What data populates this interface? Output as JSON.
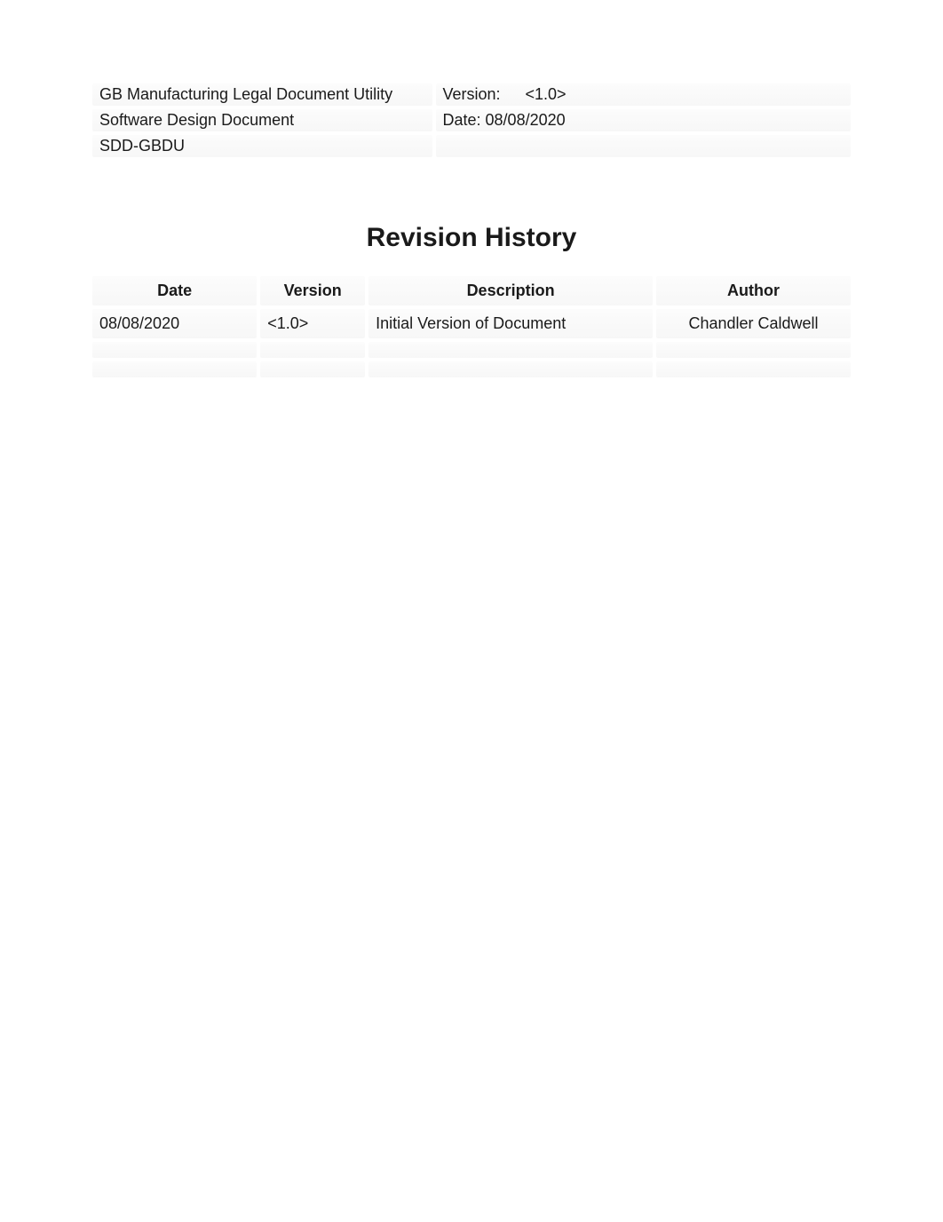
{
  "header": {
    "title": "GB Manufacturing Legal Document Utility",
    "doc_type": "Software Design Document",
    "doc_id": "SDD-GBDU",
    "version_label": "Version:",
    "version_value": "<1.0>",
    "date_label": "Date: ",
    "date_value": "08/08/2020"
  },
  "page_title": "Revision History",
  "revision_table": {
    "headers": {
      "date": "Date",
      "version": "Version",
      "description": "Description",
      "author": "Author"
    },
    "rows": [
      {
        "date": "08/08/2020",
        "version": "<1.0>",
        "description": "Initial Version of Document",
        "author": "Chandler Caldwell"
      }
    ]
  }
}
